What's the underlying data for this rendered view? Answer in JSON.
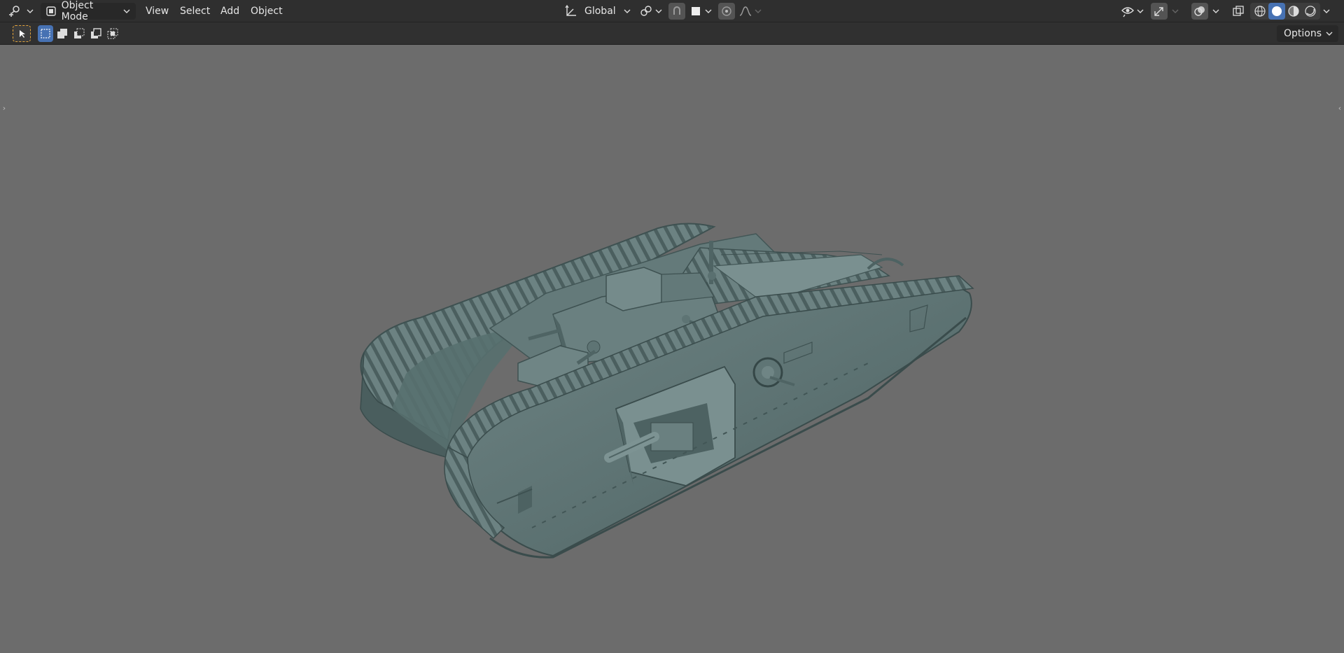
{
  "header": {
    "mode_label": "Object Mode",
    "menus": [
      "View",
      "Select",
      "Add",
      "Object"
    ],
    "transform_orientation": "Global",
    "icons": {
      "editor_type": "editor-type-icon",
      "object_mode": "object-mode-icon",
      "orientation": "transform-orientation-icon",
      "pivot": "pivot-point-icon",
      "snap": "snap-icon",
      "snap_target": "snap-target-icon",
      "proportional": "proportional-edit-icon",
      "falloff": "falloff-curve-icon",
      "visibility": "visibility-icon",
      "gizmo": "gizmo-icon",
      "overlays": "overlays-icon",
      "xray": "xray-icon",
      "shading_wire": "wireframe-shading-icon",
      "shading_solid": "solid-shading-icon",
      "shading_material": "material-shading-icon",
      "shading_rendered": "rendered-shading-icon"
    }
  },
  "toolbar": {
    "options_label": "Options",
    "select_modes": [
      "select-new-icon",
      "select-extend-icon",
      "select-subtract-icon",
      "select-invert-icon",
      "select-intersect-icon"
    ]
  },
  "viewport": {
    "background_color": "#6c6c6c",
    "model_color": "#5f7474",
    "model_description": "tank-model"
  },
  "colors": {
    "accent": "#4772b3",
    "header_bg": "#2f2f2f",
    "widget_bg": "#282828"
  }
}
